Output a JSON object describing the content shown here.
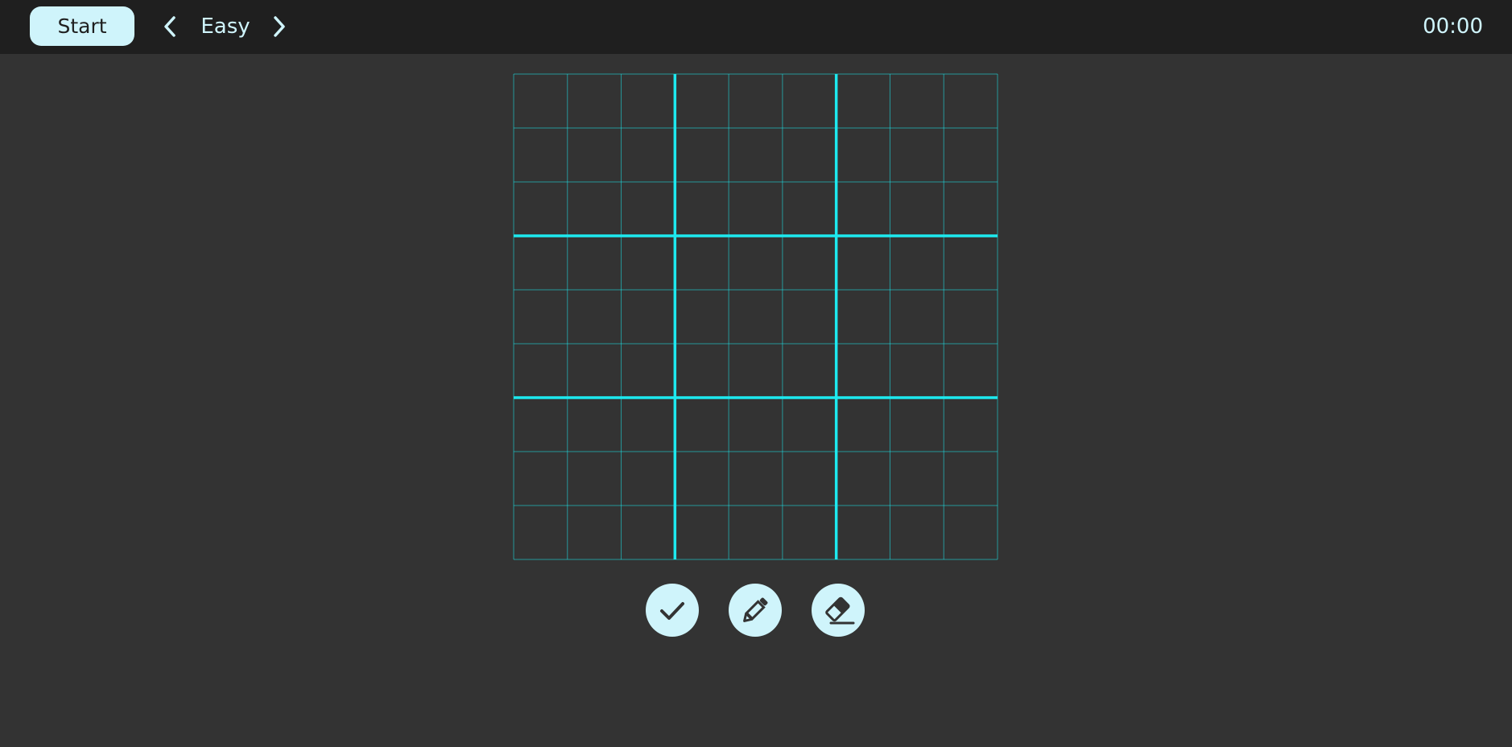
{
  "header": {
    "start_label": "Start",
    "difficulty": "Easy",
    "timer": "00:00",
    "prev_icon": "chevron-left-icon",
    "next_icon": "chevron-right-icon"
  },
  "board": {
    "size": 9,
    "box_size": 3,
    "cells": [
      [
        "",
        "",
        "",
        "",
        "",
        "",
        "",
        "",
        ""
      ],
      [
        "",
        "",
        "",
        "",
        "",
        "",
        "",
        "",
        ""
      ],
      [
        "",
        "",
        "",
        "",
        "",
        "",
        "",
        "",
        ""
      ],
      [
        "",
        "",
        "",
        "",
        "",
        "",
        "",
        "",
        ""
      ],
      [
        "",
        "",
        "",
        "",
        "",
        "",
        "",
        "",
        ""
      ],
      [
        "",
        "",
        "",
        "",
        "",
        "",
        "",
        "",
        ""
      ],
      [
        "",
        "",
        "",
        "",
        "",
        "",
        "",
        "",
        ""
      ],
      [
        "",
        "",
        "",
        "",
        "",
        "",
        "",
        "",
        ""
      ],
      [
        "",
        "",
        "",
        "",
        "",
        "",
        "",
        "",
        ""
      ]
    ]
  },
  "tools": [
    {
      "name": "check",
      "icon": "check-icon"
    },
    {
      "name": "pencil",
      "icon": "pencil-icon"
    },
    {
      "name": "eraser",
      "icon": "eraser-icon"
    }
  ],
  "colors": {
    "background": "#333333",
    "topbar": "#1f1f1f",
    "accent": "#cff4fb",
    "grid": "#1de9ef",
    "text_dark": "#1f1f1f"
  }
}
